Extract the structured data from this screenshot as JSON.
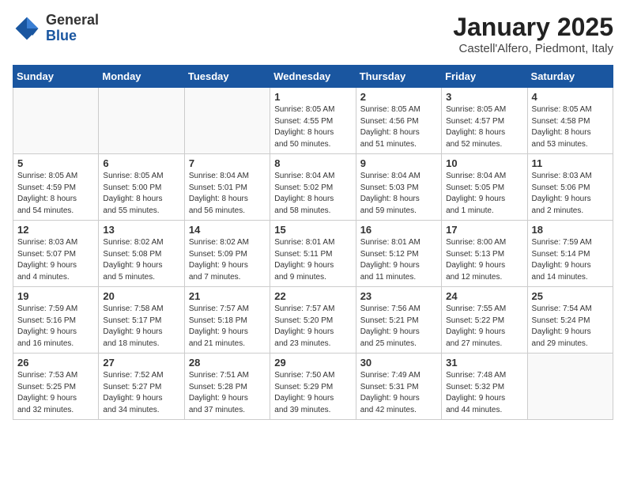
{
  "logo": {
    "general": "General",
    "blue": "Blue"
  },
  "header": {
    "title": "January 2025",
    "subtitle": "Castell'Alfero, Piedmont, Italy"
  },
  "weekdays": [
    "Sunday",
    "Monday",
    "Tuesday",
    "Wednesday",
    "Thursday",
    "Friday",
    "Saturday"
  ],
  "weeks": [
    [
      {
        "day": "",
        "info": ""
      },
      {
        "day": "",
        "info": ""
      },
      {
        "day": "",
        "info": ""
      },
      {
        "day": "1",
        "info": "Sunrise: 8:05 AM\nSunset: 4:55 PM\nDaylight: 8 hours\nand 50 minutes."
      },
      {
        "day": "2",
        "info": "Sunrise: 8:05 AM\nSunset: 4:56 PM\nDaylight: 8 hours\nand 51 minutes."
      },
      {
        "day": "3",
        "info": "Sunrise: 8:05 AM\nSunset: 4:57 PM\nDaylight: 8 hours\nand 52 minutes."
      },
      {
        "day": "4",
        "info": "Sunrise: 8:05 AM\nSunset: 4:58 PM\nDaylight: 8 hours\nand 53 minutes."
      }
    ],
    [
      {
        "day": "5",
        "info": "Sunrise: 8:05 AM\nSunset: 4:59 PM\nDaylight: 8 hours\nand 54 minutes."
      },
      {
        "day": "6",
        "info": "Sunrise: 8:05 AM\nSunset: 5:00 PM\nDaylight: 8 hours\nand 55 minutes."
      },
      {
        "day": "7",
        "info": "Sunrise: 8:04 AM\nSunset: 5:01 PM\nDaylight: 8 hours\nand 56 minutes."
      },
      {
        "day": "8",
        "info": "Sunrise: 8:04 AM\nSunset: 5:02 PM\nDaylight: 8 hours\nand 58 minutes."
      },
      {
        "day": "9",
        "info": "Sunrise: 8:04 AM\nSunset: 5:03 PM\nDaylight: 8 hours\nand 59 minutes."
      },
      {
        "day": "10",
        "info": "Sunrise: 8:04 AM\nSunset: 5:05 PM\nDaylight: 9 hours\nand 1 minute."
      },
      {
        "day": "11",
        "info": "Sunrise: 8:03 AM\nSunset: 5:06 PM\nDaylight: 9 hours\nand 2 minutes."
      }
    ],
    [
      {
        "day": "12",
        "info": "Sunrise: 8:03 AM\nSunset: 5:07 PM\nDaylight: 9 hours\nand 4 minutes."
      },
      {
        "day": "13",
        "info": "Sunrise: 8:02 AM\nSunset: 5:08 PM\nDaylight: 9 hours\nand 5 minutes."
      },
      {
        "day": "14",
        "info": "Sunrise: 8:02 AM\nSunset: 5:09 PM\nDaylight: 9 hours\nand 7 minutes."
      },
      {
        "day": "15",
        "info": "Sunrise: 8:01 AM\nSunset: 5:11 PM\nDaylight: 9 hours\nand 9 minutes."
      },
      {
        "day": "16",
        "info": "Sunrise: 8:01 AM\nSunset: 5:12 PM\nDaylight: 9 hours\nand 11 minutes."
      },
      {
        "day": "17",
        "info": "Sunrise: 8:00 AM\nSunset: 5:13 PM\nDaylight: 9 hours\nand 12 minutes."
      },
      {
        "day": "18",
        "info": "Sunrise: 7:59 AM\nSunset: 5:14 PM\nDaylight: 9 hours\nand 14 minutes."
      }
    ],
    [
      {
        "day": "19",
        "info": "Sunrise: 7:59 AM\nSunset: 5:16 PM\nDaylight: 9 hours\nand 16 minutes."
      },
      {
        "day": "20",
        "info": "Sunrise: 7:58 AM\nSunset: 5:17 PM\nDaylight: 9 hours\nand 18 minutes."
      },
      {
        "day": "21",
        "info": "Sunrise: 7:57 AM\nSunset: 5:18 PM\nDaylight: 9 hours\nand 21 minutes."
      },
      {
        "day": "22",
        "info": "Sunrise: 7:57 AM\nSunset: 5:20 PM\nDaylight: 9 hours\nand 23 minutes."
      },
      {
        "day": "23",
        "info": "Sunrise: 7:56 AM\nSunset: 5:21 PM\nDaylight: 9 hours\nand 25 minutes."
      },
      {
        "day": "24",
        "info": "Sunrise: 7:55 AM\nSunset: 5:22 PM\nDaylight: 9 hours\nand 27 minutes."
      },
      {
        "day": "25",
        "info": "Sunrise: 7:54 AM\nSunset: 5:24 PM\nDaylight: 9 hours\nand 29 minutes."
      }
    ],
    [
      {
        "day": "26",
        "info": "Sunrise: 7:53 AM\nSunset: 5:25 PM\nDaylight: 9 hours\nand 32 minutes."
      },
      {
        "day": "27",
        "info": "Sunrise: 7:52 AM\nSunset: 5:27 PM\nDaylight: 9 hours\nand 34 minutes."
      },
      {
        "day": "28",
        "info": "Sunrise: 7:51 AM\nSunset: 5:28 PM\nDaylight: 9 hours\nand 37 minutes."
      },
      {
        "day": "29",
        "info": "Sunrise: 7:50 AM\nSunset: 5:29 PM\nDaylight: 9 hours\nand 39 minutes."
      },
      {
        "day": "30",
        "info": "Sunrise: 7:49 AM\nSunset: 5:31 PM\nDaylight: 9 hours\nand 42 minutes."
      },
      {
        "day": "31",
        "info": "Sunrise: 7:48 AM\nSunset: 5:32 PM\nDaylight: 9 hours\nand 44 minutes."
      },
      {
        "day": "",
        "info": ""
      }
    ]
  ]
}
